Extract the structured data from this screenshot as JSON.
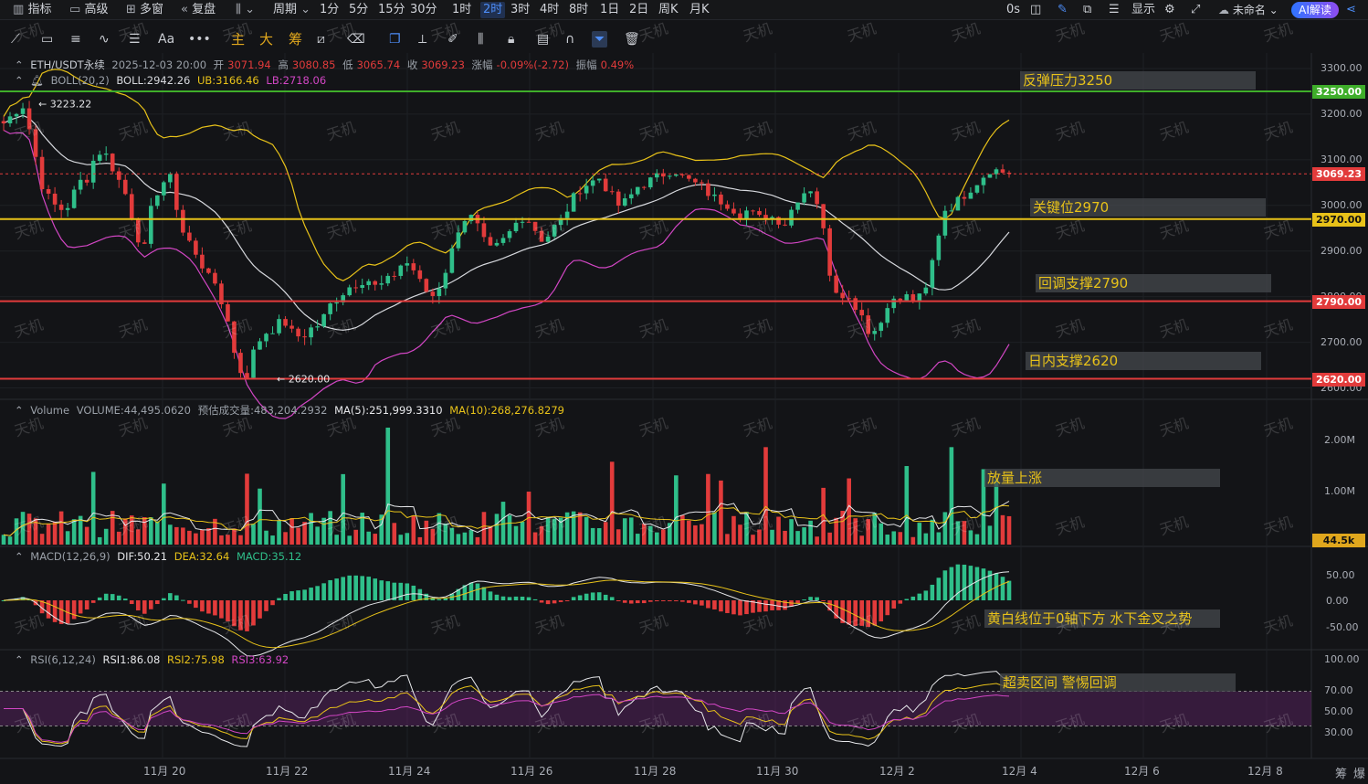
{
  "topbar": {
    "items": [
      {
        "label": "指标",
        "icon": "indicator-icon"
      },
      {
        "label": "高级",
        "icon": "calendar-icon"
      },
      {
        "label": "多窗",
        "icon": "grid-icon"
      },
      {
        "label": "复盘",
        "icon": "rewind-icon"
      },
      {
        "label": "",
        "icon": "candles-dropdown-icon"
      },
      {
        "label": "周期",
        "icon": "chevron-down-icon"
      }
    ],
    "intervals": [
      "1分",
      "5分",
      "15分",
      "30分",
      "1时",
      "2时",
      "3时",
      "4时",
      "8时",
      "1日",
      "2日",
      "周K",
      "月K"
    ],
    "active_interval": "2时",
    "countdown": "0s",
    "display_label": "显示",
    "unnamed_label": "未命名",
    "ai_label": "AI解读"
  },
  "toolbar": {
    "tools": [
      "trend-line",
      "rectangle",
      "parallel-channel",
      "wave",
      "fib-lines",
      "text",
      "more"
    ],
    "text_tool": "Aa",
    "more": "•••",
    "toggles": [
      "主",
      "大",
      "筹"
    ],
    "right_tools": [
      "copy",
      "ruler",
      "brush",
      "bars",
      "lock",
      "clipboard",
      "magnet",
      "filter",
      "trash"
    ]
  },
  "legend": {
    "symbol": "ETH/USDT永续",
    "datetime": "2025-12-03 20:00",
    "open_label": "开",
    "open": "3071.94",
    "high_label": "高",
    "high": "3080.85",
    "low_label": "低",
    "low": "3065.74",
    "close_label": "收",
    "close": "3069.23",
    "change_label": "涨幅",
    "change": "-0.09%(-2.72)",
    "amp_label": "振幅",
    "amp": "0.49%",
    "boll_name": "BOLL(20,2)",
    "boll": "BOLL:2942.26",
    "ub": "UB:3166.46",
    "lb": "LB:2718.06"
  },
  "volume_legend": {
    "name": "Volume",
    "volume": "VOLUME:44,495.0620",
    "forecast": "预估成交量:483,204.2932",
    "ma5": "MA(5):251,999.3310",
    "ma10": "MA(10):268,276.8279"
  },
  "macd_legend": {
    "name": "MACD(12,26,9)",
    "dif": "DIF:50.21",
    "dea": "DEA:32.64",
    "macd": "MACD:35.12"
  },
  "rsi_legend": {
    "name": "RSI(6,12,24)",
    "rsi1": "RSI1:86.08",
    "rsi2": "RSI2:75.98",
    "rsi3": "RSI3:63.92"
  },
  "annotations": {
    "a1": "反弹压力3250",
    "a2": "关键位2970",
    "a3": "回调支撑2790",
    "a4": "日内支撑2620",
    "a5": "放量上涨",
    "a6": "黄白线位于0轴下方 水下金叉之势",
    "a7": "超卖区间 警惕回调"
  },
  "price_axis": {
    "ticks": [
      "3300.00",
      "3200.00",
      "3100.00",
      "3000.00",
      "2900.00",
      "2800.00",
      "2700.00",
      "2600.00"
    ],
    "tags": [
      {
        "value": "3250.00",
        "color": "#3fae2a"
      },
      {
        "value": "3069.23",
        "color": "#e23b3b"
      },
      {
        "value": "2970.00",
        "color": "#e8c219"
      },
      {
        "value": "2790.00",
        "color": "#e23b3b"
      },
      {
        "value": "2620.00",
        "color": "#e23b3b"
      }
    ],
    "high_mark": "3223.22",
    "low_mark": "2620.00"
  },
  "volume_axis": {
    "ticks": [
      "2.00M",
      "1.00M"
    ],
    "current": "44.5k"
  },
  "macd_axis": {
    "ticks": [
      "50.00",
      "0.00",
      "-50.00"
    ]
  },
  "rsi_axis": {
    "ticks": [
      "100.00",
      "70.00",
      "50.00",
      "30.00"
    ]
  },
  "x_axis": {
    "labels": [
      "11月 20",
      "11月 22",
      "11月 24",
      "11月 26",
      "11月 28",
      "11月 30",
      "12月 2",
      "12月 4",
      "12月 6",
      "12月 8"
    ]
  },
  "corner": {
    "left": "筹",
    "right": "爆"
  },
  "watermark": "天机",
  "chart_data": {
    "type": "candlestick",
    "levels": {
      "resistance": 3250,
      "key": 2970,
      "support1": 2790,
      "support2": 2620,
      "last": 3069.23
    },
    "price_path": [
      3180,
      3200,
      3223,
      3150,
      3050,
      3010,
      2990,
      3000,
      3050,
      3060,
      3120,
      3110,
      3070,
      3030,
      2960,
      2890,
      3010,
      3050,
      3060,
      2950,
      2920,
      2870,
      2860,
      2800,
      2760,
      2650,
      2620,
      2690,
      2720,
      2730,
      2750,
      2720,
      2710,
      2730,
      2740,
      2780,
      2800,
      2820,
      2830,
      2840,
      2820,
      2830,
      2850,
      2880,
      2860,
      2820,
      2800,
      2830,
      2890,
      2960,
      2980,
      2950,
      2900,
      2910,
      2930,
      2960,
      2980,
      2950,
      2920,
      2950,
      2970,
      3010,
      3040,
      3050,
      3060,
      3030,
      3000,
      3010,
      3040,
      3050,
      3060,
      3070,
      3080,
      3060,
      3050,
      3040,
      3020,
      3010,
      3000,
      2980,
      2990,
      2970,
      2980,
      2970,
      2960,
      3010,
      3030,
      3040,
      2950,
      2820,
      2810,
      2790,
      2770,
      2720,
      2730,
      2790,
      2790,
      2800,
      2790,
      2810,
      2900,
      2990,
      3000,
      3020,
      3040,
      3060,
      3080,
      3075,
      3069
    ],
    "volume": {
      "unit": "volume",
      "ma_lines": [
        "MA(5)",
        "MA(10)"
      ]
    },
    "macd": {
      "zero": 0,
      "last_dif": 50.21,
      "last_dea": 32.64,
      "last_macd": 35.12
    },
    "rsi": {
      "overbought": 70,
      "oversold": 30,
      "last": [
        86.08,
        75.98,
        63.92
      ]
    }
  }
}
